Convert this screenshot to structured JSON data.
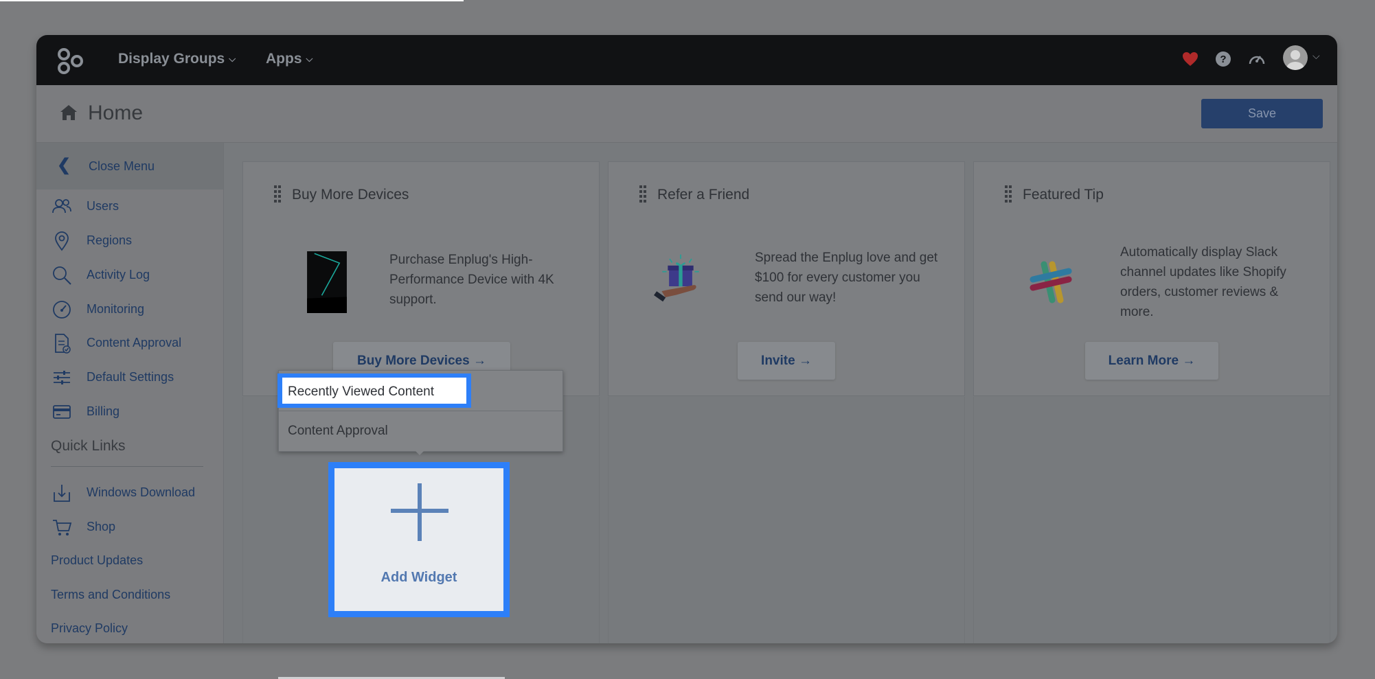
{
  "topbar": {
    "nav": [
      {
        "label": "Display Groups"
      },
      {
        "label": "Apps"
      }
    ],
    "icons": [
      "heart-icon",
      "help-icon",
      "speedometer-icon",
      "avatar-icon"
    ]
  },
  "header": {
    "title": "Home",
    "save_label": "Save"
  },
  "sidebar": {
    "close_label": "Close Menu",
    "items": [
      {
        "label": "Users",
        "icon": "users-icon"
      },
      {
        "label": "Regions",
        "icon": "location-pin-icon"
      },
      {
        "label": "Activity Log",
        "icon": "search-icon"
      },
      {
        "label": "Monitoring",
        "icon": "gauge-icon"
      },
      {
        "label": "Content Approval",
        "icon": "document-check-icon"
      },
      {
        "label": "Default Settings",
        "icon": "sliders-icon"
      },
      {
        "label": "Billing",
        "icon": "credit-card-icon"
      }
    ],
    "quick_links_heading": "Quick Links",
    "quick_links": [
      {
        "label": "Windows Download",
        "icon": "download-icon"
      },
      {
        "label": "Shop",
        "icon": "cart-icon"
      }
    ],
    "links": [
      "Product Updates",
      "Terms and Conditions",
      "Privacy Policy"
    ]
  },
  "cards": [
    {
      "title": "Buy More Devices",
      "text": "Purchase Enplug's High-Performance Device with 4K support.",
      "button": "Buy More Devices →"
    },
    {
      "title": "Refer a Friend",
      "text": "Spread the Enplug love and get $100 for every customer you send our way!",
      "button": "Invite →"
    },
    {
      "title": "Featured Tip",
      "text": "Automatically display Slack channel updates like Shopify orders, customer reviews & more.",
      "button": "Learn More →"
    }
  ],
  "dropdown": {
    "items": [
      "Recently Viewed Content",
      "Content Approval"
    ]
  },
  "add_widget": {
    "label": "Add Widget"
  },
  "colors": {
    "accent_highlight": "#2d7ff8",
    "link_blue": "#1f3a63",
    "topbar": "#111214",
    "heart": "#b02a2a"
  }
}
